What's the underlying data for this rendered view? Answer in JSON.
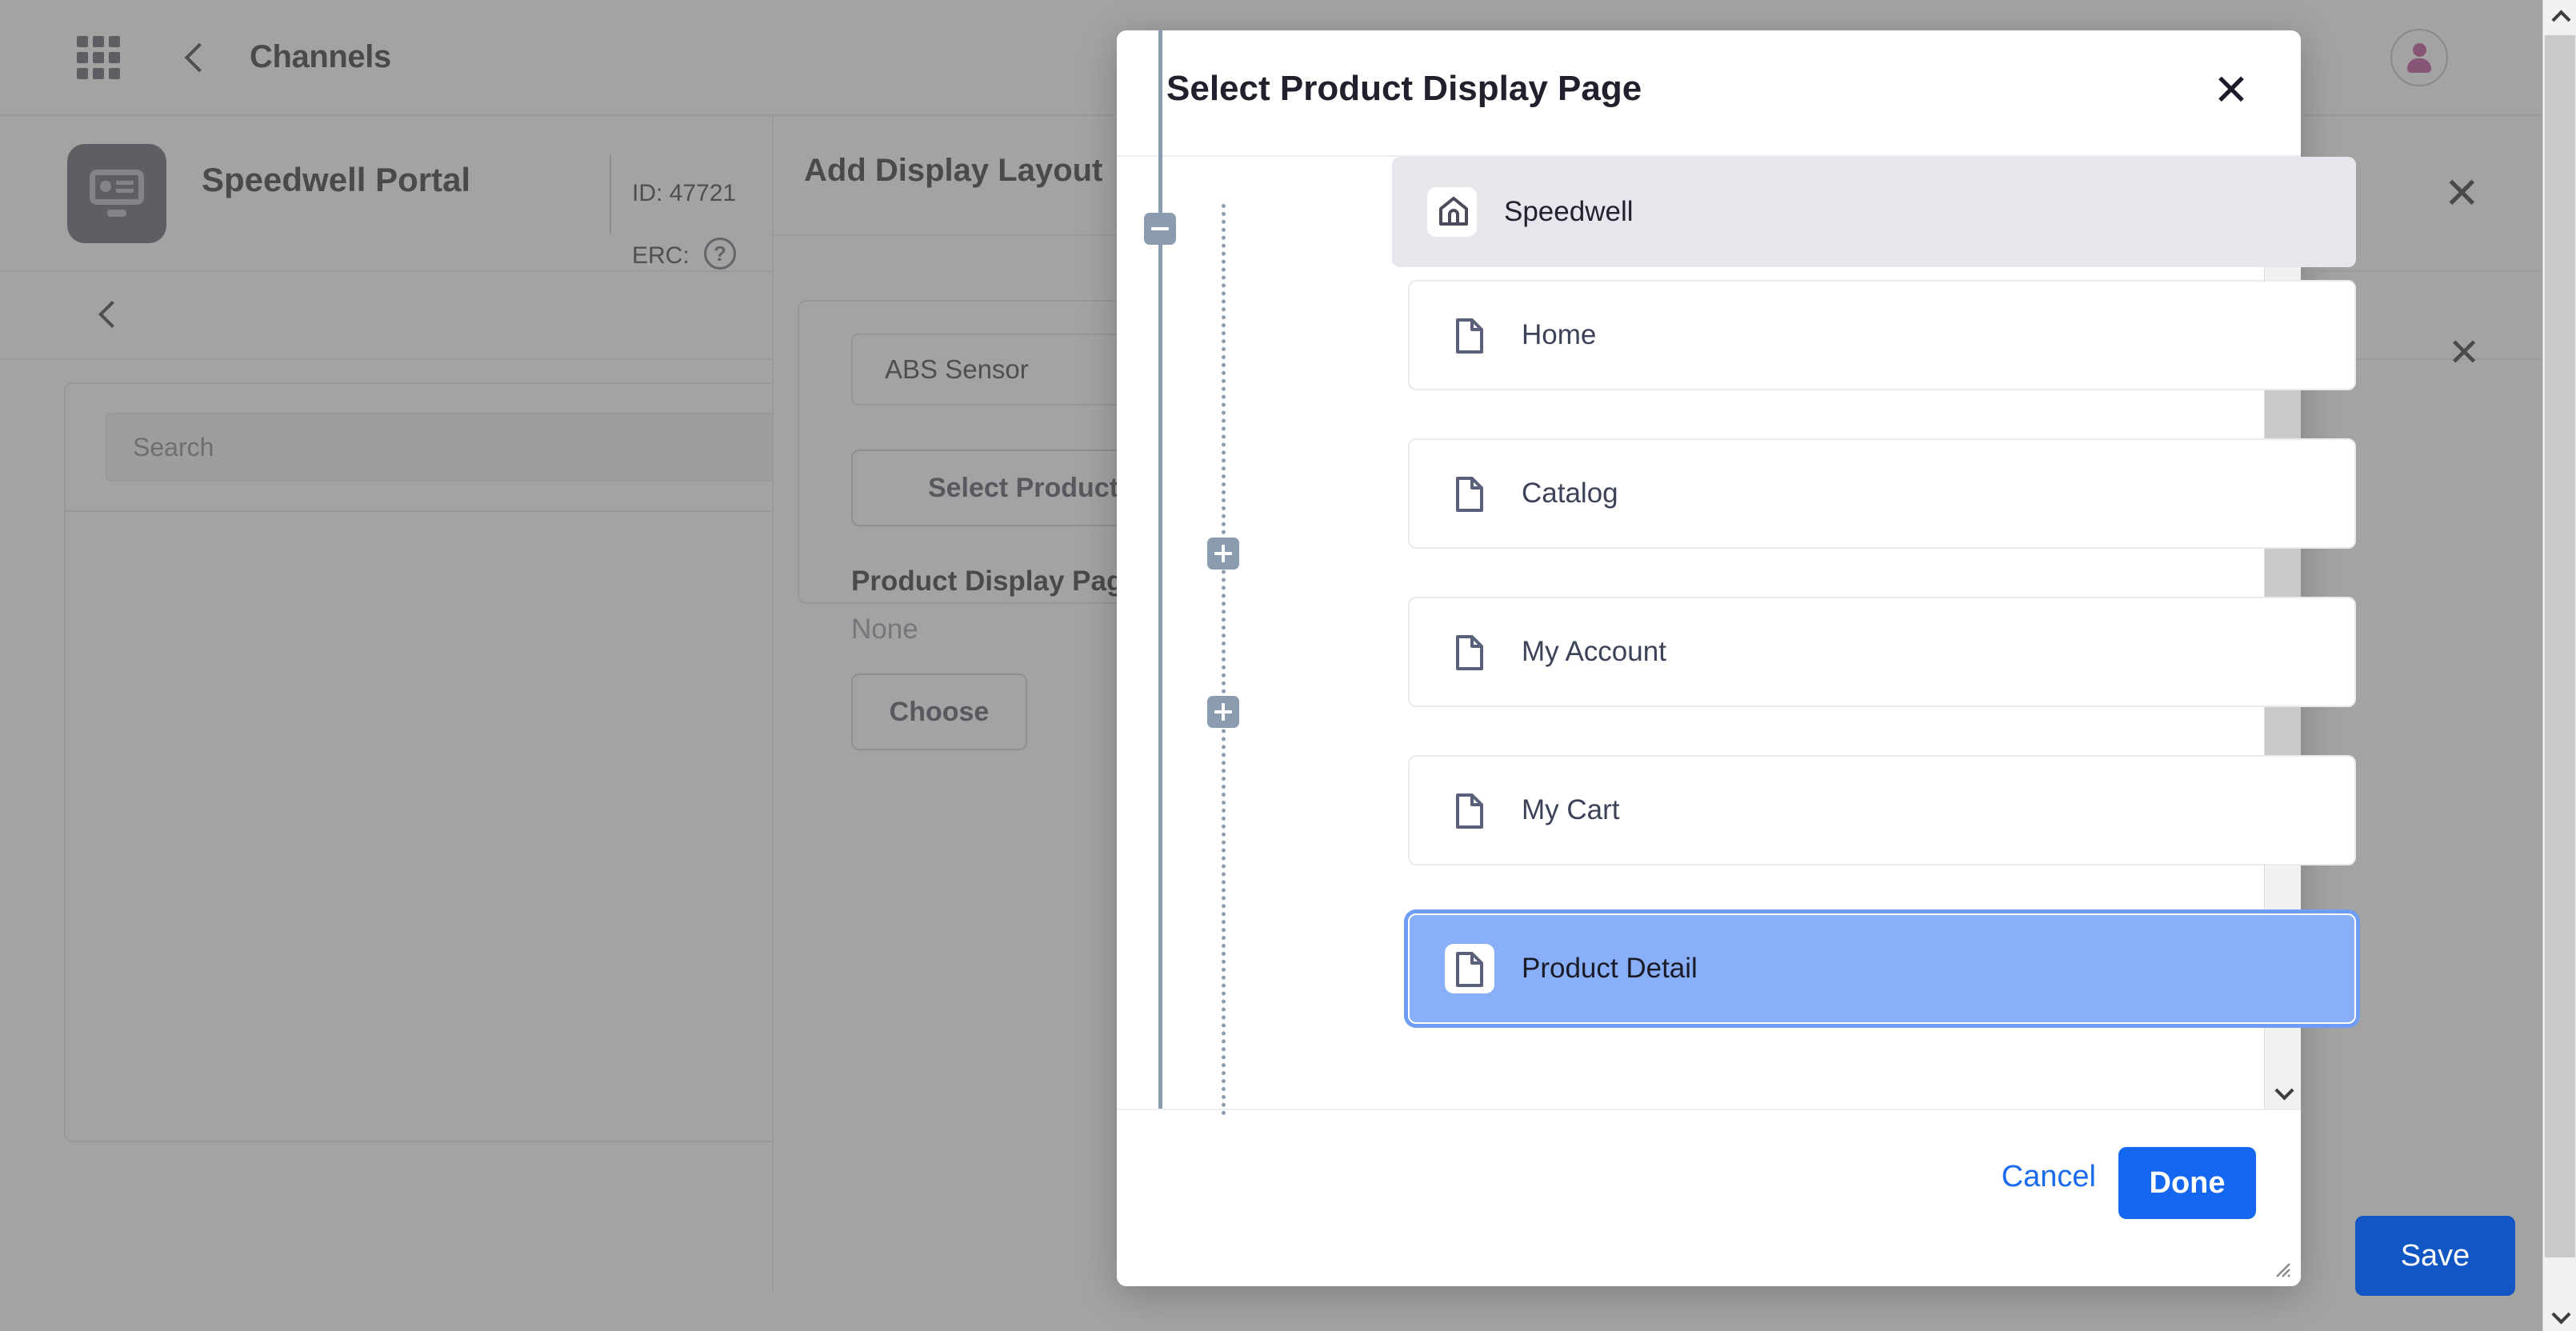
{
  "topbar": {
    "apps_icon": "apps-grid-icon",
    "back_icon": "chevron-left-icon",
    "title": "Channels",
    "avatar_icon": "user-avatar-icon"
  },
  "portal_header": {
    "icon": "display-monitor-icon",
    "title": "Speedwell Portal",
    "id_label": "ID: 47721",
    "erc_label": "ERC:",
    "help_icon": "question-mark-icon",
    "close_icon": "close-icon"
  },
  "subbar": {
    "back_icon": "chevron-left-icon"
  },
  "left_panel": {
    "search_placeholder": "Search",
    "search_value": "",
    "close_icon": "close-icon"
  },
  "add_display_layout": {
    "title": "Add Display Layout",
    "product_field_value": "ABS Sensor",
    "select_product_label": "Select Product",
    "product_display_page_label": "Product Display Page",
    "product_display_page_value": "None",
    "choose_label": "Choose",
    "close_icon": "close-icon",
    "save_label": "Save"
  },
  "modal": {
    "title": "Select Product Display Page",
    "close_icon": "close-icon",
    "cancel_label": "Cancel",
    "done_label": "Done",
    "resize_icon": "resize-grip-icon",
    "tree": {
      "root": {
        "label": "Speedwell",
        "icon": "home-icon",
        "toggle": "minus-icon",
        "expanded": true,
        "selected": false
      },
      "children": [
        {
          "label": "Home",
          "icon": "document-icon",
          "toggle": null,
          "selected": false
        },
        {
          "label": "Catalog",
          "icon": "document-icon",
          "toggle": "plus-icon",
          "selected": false
        },
        {
          "label": "My Account",
          "icon": "document-icon",
          "toggle": "plus-icon",
          "selected": false
        },
        {
          "label": "My Cart",
          "icon": "document-icon",
          "toggle": null,
          "selected": false
        },
        {
          "label": "Product Detail",
          "icon": "document-icon",
          "toggle": null,
          "selected": true
        }
      ]
    }
  },
  "scrollbars": {
    "up_icon": "chevron-up-icon",
    "down_icon": "chevron-down-icon"
  },
  "colors": {
    "accent_blue": "#1566f0",
    "selection_blue": "#88aff8",
    "save_blue": "#0b57d0",
    "tree_line": "#8b9bb0",
    "dark_panel": "#4b4b5c",
    "avatar_magenta": "#b53389"
  }
}
